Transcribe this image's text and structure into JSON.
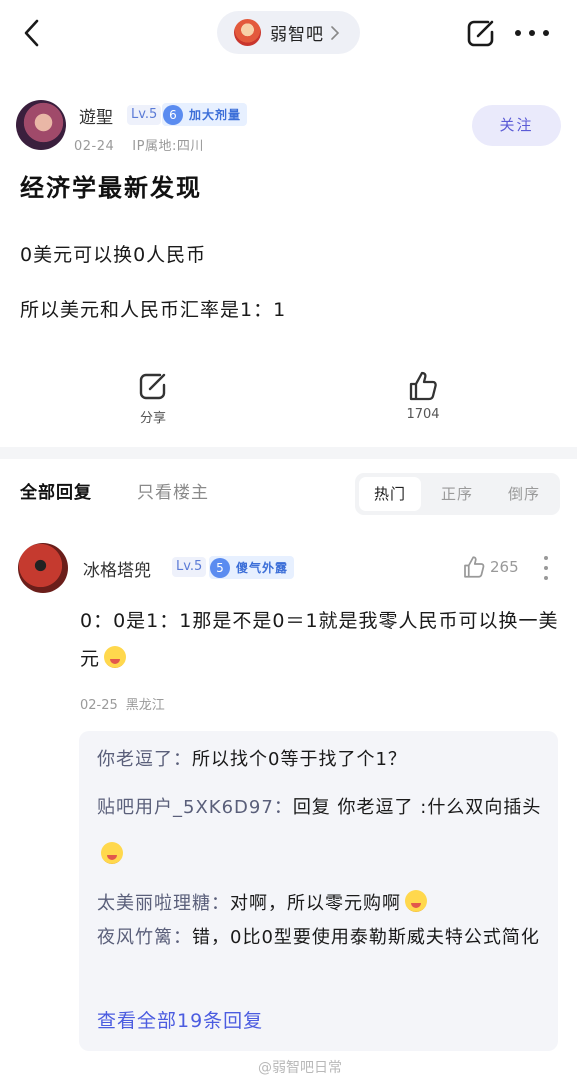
{
  "forum": {
    "name": "弱智吧"
  },
  "author": {
    "name": "遊聖",
    "level": "Lv.5",
    "badge_num": "6",
    "badge_text": "加大剂量",
    "date": "02-24",
    "ip": "IP属地:四川",
    "follow_label": "关注"
  },
  "post": {
    "title": "经济学最新发现",
    "lines": [
      "0美元可以换0人民币",
      "所以美元和人民币汇率是1：1"
    ]
  },
  "actions": {
    "share_label": "分享",
    "like_count": "1704"
  },
  "reply_tabs": {
    "all": "全部回复",
    "op_only": "只看楼主",
    "sort": [
      "热门",
      "正序",
      "倒序"
    ],
    "sort_active": "热门"
  },
  "comment": {
    "name": "冰格塔兜",
    "level": "Lv.5",
    "badge_num": "5",
    "badge_text": "傻气外露",
    "likes": "265",
    "text": "0：0是1：1那是不是0＝1就是我零人民币可以换一美元",
    "date": "02-25",
    "location": "黑龙江",
    "emoji": "drooling-face-emoji"
  },
  "sub_replies": [
    {
      "who": "你老逗了",
      "sep": "：",
      "text": "所以找个0等于找了个1？"
    },
    {
      "who": "贴吧用户_5XK6D97",
      "sep": "：",
      "text": "回复 你老逗了 :什么双向插头",
      "emoji": "grinning-sweat-emoji"
    },
    {
      "who": "太美丽啦理糖",
      "sep": "：",
      "text": "对啊，所以零元购啊",
      "emoji": "drooling-face-emoji"
    },
    {
      "who": "夜风竹篱",
      "sep": "：",
      "text": "错，0比0型要使用泰勒斯威夫特公式简化"
    }
  ],
  "view_all": "查看全部19条回复",
  "watermark": "@弱智吧日常",
  "colors": {
    "accent": "#4b5ce0",
    "follow_bg": "#eaeafb",
    "badge_bg": "#e7f0ff",
    "level": "#5b7bd6"
  }
}
